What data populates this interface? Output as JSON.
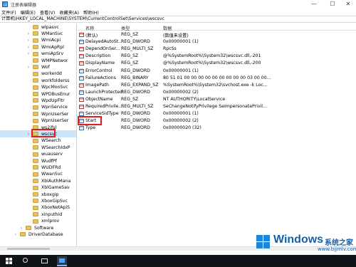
{
  "window": {
    "title": "注册表编辑器",
    "controls": {
      "minimize": "—",
      "maximize": "☐",
      "close": "✕"
    }
  },
  "menu": [
    "文件(F)",
    "编辑(E)",
    "查看(V)",
    "收藏夹(A)",
    "帮助(H)"
  ],
  "address": "计算机\\HKEY_LOCAL_MACHINE\\SYSTEM\\CurrentControlSet\\Services\\wscsvc",
  "tree": [
    {
      "label": "wlpasvc",
      "arrow": ""
    },
    {
      "label": "WManSvc",
      "arrow": "›"
    },
    {
      "label": "WmiAcpi",
      "arrow": "›"
    },
    {
      "label": "WmiApRpl",
      "arrow": "›"
    },
    {
      "label": "wmiApSrv",
      "arrow": "›"
    },
    {
      "label": "WMPNetwor",
      "arrow": ""
    },
    {
      "label": "Wof",
      "arrow": "›"
    },
    {
      "label": "workerdd",
      "arrow": ""
    },
    {
      "label": "workfolderss",
      "arrow": ""
    },
    {
      "label": "WpcMonSvc",
      "arrow": ""
    },
    {
      "label": "WPDBusEnur",
      "arrow": ""
    },
    {
      "label": "WpdUpFltr",
      "arrow": ""
    },
    {
      "label": "WpnService",
      "arrow": ""
    },
    {
      "label": "WpnUserSer",
      "arrow": ""
    },
    {
      "label": "WpnUserSer",
      "arrow": ""
    },
    {
      "label": "ws2ifsl",
      "arrow": ""
    },
    {
      "label": "wscsvc",
      "arrow": "›",
      "selected": true
    },
    {
      "label": "WSearch",
      "arrow": ""
    },
    {
      "label": "WSearchIdxP",
      "arrow": ""
    },
    {
      "label": "wuauserv",
      "arrow": ""
    },
    {
      "label": "WudfPf",
      "arrow": ""
    },
    {
      "label": "WUDFRd",
      "arrow": ""
    },
    {
      "label": "WwanSvc",
      "arrow": ""
    },
    {
      "label": "XblAuthMana",
      "arrow": ""
    },
    {
      "label": "XblGameSav",
      "arrow": ""
    },
    {
      "label": "xboxgip",
      "arrow": ""
    },
    {
      "label": "XboxGipSvc",
      "arrow": ""
    },
    {
      "label": "XboxNetApiS",
      "arrow": ""
    },
    {
      "label": "xinputhid",
      "arrow": ""
    },
    {
      "label": "xmlprov",
      "arrow": ""
    },
    {
      "label": "Software",
      "arrow": "›"
    },
    {
      "label": "DriverDatabase",
      "arrow": "›"
    }
  ],
  "values_header": {
    "name": "名称",
    "type": "类型",
    "data": "数据"
  },
  "values": [
    {
      "name": "(默认)",
      "type": "REG_SZ",
      "data": "(数值未设置)",
      "kind": "sz"
    },
    {
      "name": "DelayedAutoSt...",
      "type": "REG_DWORD",
      "data": "0x00000001 (1)",
      "kind": "num"
    },
    {
      "name": "DependOnSer...",
      "type": "REG_MULTI_SZ",
      "data": "RpcSs",
      "kind": "sz"
    },
    {
      "name": "Description",
      "type": "REG_SZ",
      "data": "@%SystemRoot%\\System32\\wscsvc.dll,-201",
      "kind": "sz"
    },
    {
      "name": "DisplayName",
      "type": "REG_SZ",
      "data": "@%SystemRoot%\\System32\\wscsvc.dll,-200",
      "kind": "sz"
    },
    {
      "name": "ErrorControl",
      "type": "REG_DWORD",
      "data": "0x00000001 (1)",
      "kind": "num"
    },
    {
      "name": "FailureActions",
      "type": "REG_BINARY",
      "data": "80 51 01 00 00 00 00 00 00 00 00 00 03 00 00...",
      "kind": "num"
    },
    {
      "name": "ImagePath",
      "type": "REG_EXPAND_SZ",
      "data": "%SystemRoot%\\System32\\svchost.exe -k Loc...",
      "kind": "sz"
    },
    {
      "name": "LaunchProtected",
      "type": "REG_DWORD",
      "data": "0x00000002 (2)",
      "kind": "num"
    },
    {
      "name": "ObjectName",
      "type": "REG_SZ",
      "data": "NT AUTHORITY\\LocalService",
      "kind": "sz"
    },
    {
      "name": "RequiredPrivile...",
      "type": "REG_MULTI_SZ",
      "data": "SeChangeNotifyPrivilege SeImpersonatePrivil...",
      "kind": "sz"
    },
    {
      "name": "ServiceSidType",
      "type": "REG_DWORD",
      "data": "0x00000001 (1)",
      "kind": "num"
    },
    {
      "name": "Start",
      "type": "REG_DWORD",
      "data": "0x00000002 (2)",
      "kind": "num",
      "highlighted": true
    },
    {
      "name": "Type",
      "type": "REG_DWORD",
      "data": "0x00000020 (32)",
      "kind": "num"
    }
  ],
  "watermark": {
    "brand": "Windows",
    "cn": "系统之家",
    "url": "www.bjjmlv.com"
  },
  "colors": {
    "highlight_box": "#e02020",
    "selection": "#cce4f7",
    "taskbar": "#101318",
    "watermark": "#1560a8"
  }
}
